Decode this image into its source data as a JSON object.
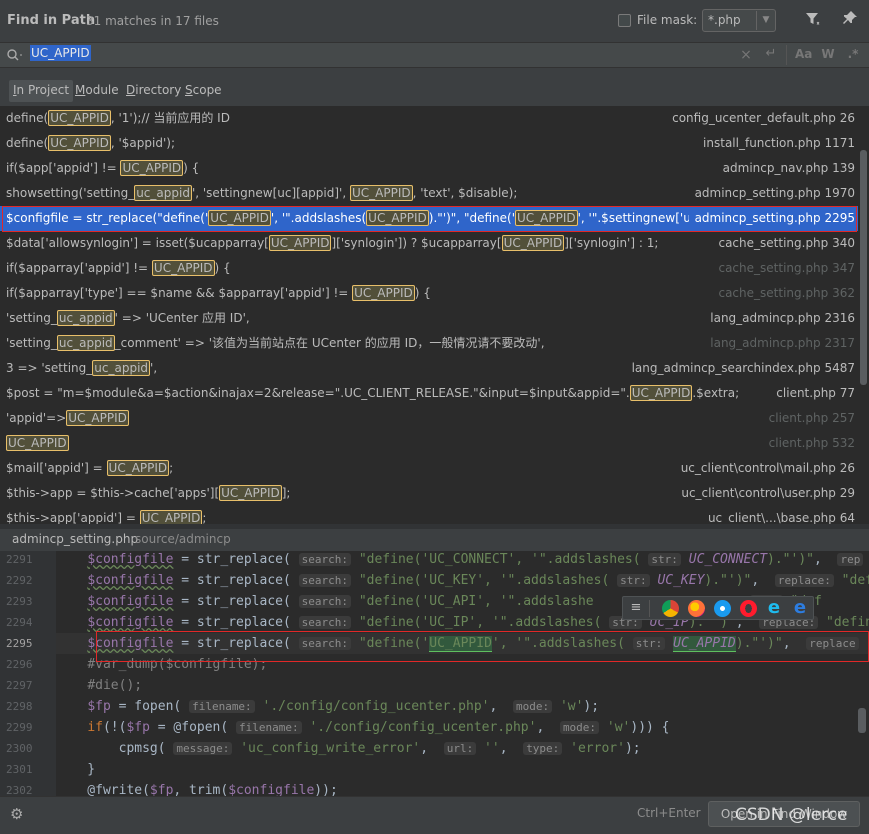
{
  "header": {
    "title": "Find in Path",
    "match_count": "31 matches in 17 files",
    "file_mask_label": "File mask:",
    "file_mask_value": "*.php"
  },
  "search": {
    "query": "UC_APPID"
  },
  "scope_tabs": [
    {
      "label": "In Project",
      "active": true
    },
    {
      "label": "Module"
    },
    {
      "label": "Directory"
    },
    {
      "label": "Scope"
    }
  ],
  "results": [
    {
      "code": [
        [
          "define(",
          ""
        ],
        [
          "UC_APPID",
          "hl"
        ],
        [
          ", '1');// 当前应用的 ID",
          ""
        ]
      ],
      "file": "config_ucenter_default.php 26"
    },
    {
      "code": [
        [
          "define(",
          ""
        ],
        [
          "UC_APPID",
          "hl"
        ],
        [
          ", '$appid');",
          ""
        ]
      ],
      "file": "install_function.php 1171"
    },
    {
      "code": [
        [
          "if($app['appid'] != ",
          ""
        ],
        [
          "UC_APPID",
          "hl"
        ],
        [
          ") {",
          ""
        ]
      ],
      "file": "admincp_nav.php 139"
    },
    {
      "code": [
        [
          "showsetting('setting_",
          ""
        ],
        [
          "uc_appid",
          "hl"
        ],
        [
          "', 'settingnew[uc][appid]', ",
          ""
        ],
        [
          "UC_APPID",
          "hl"
        ],
        [
          ", 'text', $disable);",
          ""
        ]
      ],
      "file": "admincp_setting.php 1970"
    },
    {
      "code": [
        [
          "$configfile = str_replace(\"define('",
          ""
        ],
        [
          "UC_APPID",
          "hl"
        ],
        [
          "', '\".addslashes(",
          ""
        ],
        [
          "UC_APPID",
          "hl"
        ],
        [
          ").\"')\", \"define('",
          ""
        ],
        [
          "UC_APPID",
          "hl"
        ],
        [
          "', '\".$settingnew['uc']['appid']",
          ""
        ]
      ],
      "file": "admincp_setting.php 2295",
      "selected": true
    },
    {
      "code": [
        [
          "$data['allowsynlogin'] = isset($ucapparray[",
          ""
        ],
        [
          "UC_APPID",
          "hl"
        ],
        [
          "]['synlogin']) ? $ucapparray[",
          ""
        ],
        [
          "UC_APPID",
          "hl"
        ],
        [
          "]['synlogin'] : 1;",
          ""
        ]
      ],
      "file": "cache_setting.php 340"
    },
    {
      "code": [
        [
          "if($apparray['appid'] != ",
          ""
        ],
        [
          "UC_APPID",
          "hl"
        ],
        [
          ") {",
          ""
        ]
      ],
      "file": "cache_setting.php 347",
      "dim": true
    },
    {
      "code": [
        [
          "if($apparray['type'] == $name && $apparray['appid'] != ",
          ""
        ],
        [
          "UC_APPID",
          "hl"
        ],
        [
          ") {",
          ""
        ]
      ],
      "file": "cache_setting.php 362",
      "dim": true
    },
    {
      "code": [
        [
          "'setting_",
          ""
        ],
        [
          "uc_appid",
          "hl"
        ],
        [
          "' => 'UCenter 应用 ID',",
          ""
        ]
      ],
      "file": "lang_admincp.php 2316"
    },
    {
      "code": [
        [
          "'setting_",
          ""
        ],
        [
          "uc_appid",
          "hl"
        ],
        [
          "_comment' => '该值为当前站点在 UCenter 的应用 ID，一般情况请不要改动',",
          ""
        ]
      ],
      "file": "lang_admincp.php 2317",
      "dim": true
    },
    {
      "code": [
        [
          "3 => 'setting_",
          ""
        ],
        [
          "uc_appid",
          "hl"
        ],
        [
          "',",
          ""
        ]
      ],
      "file": "lang_admincp_searchindex.php 5487"
    },
    {
      "code": [
        [
          "$post = \"m=$module&a=$action&inajax=2&release=\".UC_CLIENT_RELEASE.\"&input=$input&appid=\".",
          ""
        ],
        [
          "UC_APPID",
          "hl"
        ],
        [
          ".$extra;",
          ""
        ]
      ],
      "file": "client.php 77"
    },
    {
      "code": [
        [
          "'appid'=>",
          ""
        ],
        [
          "UC_APPID",
          "hl"
        ]
      ],
      "file": "client.php 257",
      "dim": true
    },
    {
      "code": [
        [
          "UC_APPID",
          "hl"
        ]
      ],
      "file": "client.php 532",
      "dim": true
    },
    {
      "code": [
        [
          "$mail['appid'] = ",
          ""
        ],
        [
          "UC_APPID",
          "hl"
        ],
        [
          ";",
          ""
        ]
      ],
      "file": "uc_client\\control\\mail.php 26"
    },
    {
      "code": [
        [
          "$this->app = $this->cache['apps'][",
          ""
        ],
        [
          "UC_APPID",
          "hl"
        ],
        [
          "];",
          ""
        ]
      ],
      "file": "uc_client\\control\\user.php 29"
    },
    {
      "code": [
        [
          "$this->app['appid'] = ",
          ""
        ],
        [
          "UC_APPID",
          "hl"
        ],
        [
          ";",
          ""
        ]
      ],
      "file": "uc_client\\...\\base.php 64"
    }
  ],
  "preview": {
    "file_name": "admincp_setting.php",
    "path": "source/admincp",
    "line_numbers": [
      "2291",
      "2292",
      "2293",
      "2294",
      "2295",
      "2296",
      "2297",
      "2298",
      "2299",
      "2300",
      "2301",
      "2302"
    ],
    "current_line": "2295"
  },
  "footer": {
    "shortcut": "Ctrl+Enter",
    "open_button": "Open in Find Window",
    "watermark": "CSDN @lerce"
  }
}
